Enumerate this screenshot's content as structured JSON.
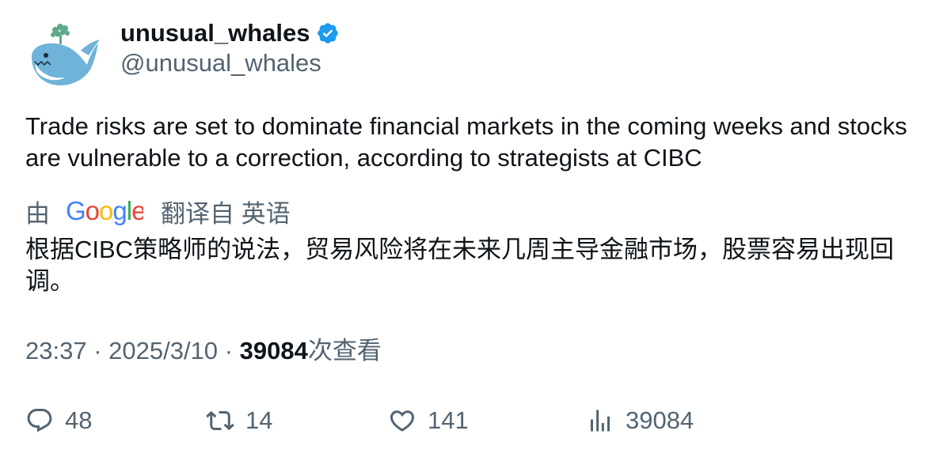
{
  "author": {
    "display_name": "unusual_whales",
    "handle": "@unusual_whales",
    "verified": true
  },
  "tweet": {
    "text": "Trade risks are set to dominate financial markets in the coming weeks and stocks are vulnerable to a correction, according to strategists at CIBC"
  },
  "translation": {
    "prefix": "由",
    "provider": "Google",
    "suffix": "翻译自 英语",
    "text": "根据CIBC策略师的说法，贸易风险将在未来几周主导金融市场，股票容易出现回调。"
  },
  "meta": {
    "time": "23:37",
    "separator": "·",
    "date": "2025/3/10",
    "views_count": "39084",
    "views_label": "次查看"
  },
  "actions": {
    "replies": "48",
    "retweets": "14",
    "likes": "141",
    "views": "39084"
  },
  "colors": {
    "text_primary": "#0f1419",
    "text_secondary": "#536471",
    "verified_blue": "#1d9bf0"
  }
}
